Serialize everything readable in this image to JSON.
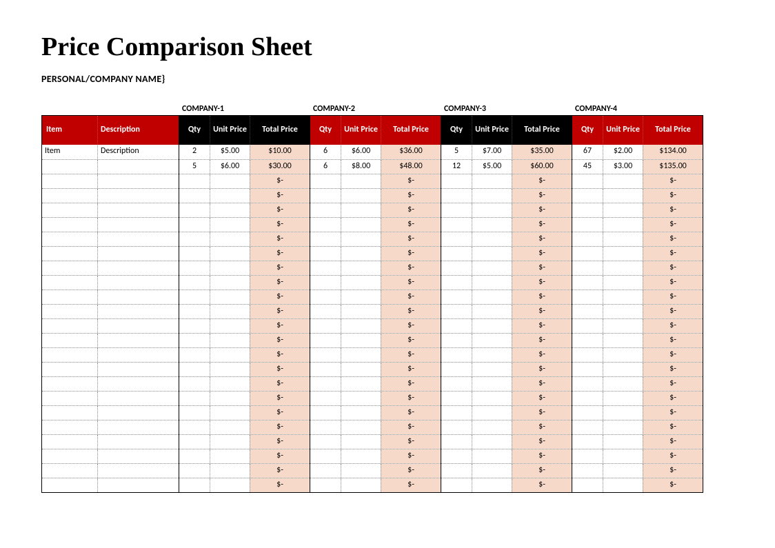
{
  "title": "Price Comparison Sheet",
  "subtitle": "PERSONAL/COMPANY NAME}",
  "columns": {
    "item": "Item",
    "description": "Description",
    "qty": "Qty",
    "unit_price": "Unit Price",
    "total_price": "Total Price"
  },
  "emptyTotal": "$-",
  "rowCount": 24,
  "itemRows": [
    {
      "item": "Item",
      "description": "Description"
    }
  ],
  "companies": [
    {
      "label": "COMPANY-1",
      "headerStyle": "black",
      "rows": [
        {
          "qty": "2",
          "unit": "$5.00",
          "total": "$10.00"
        },
        {
          "qty": "5",
          "unit": "$6.00",
          "total": "$30.00"
        }
      ]
    },
    {
      "label": "COMPANY-2",
      "headerStyle": "red",
      "rows": [
        {
          "qty": "6",
          "unit": "$6.00",
          "total": "$36.00"
        },
        {
          "qty": "6",
          "unit": "$8.00",
          "total": "$48.00"
        }
      ]
    },
    {
      "label": "COMPANY-3",
      "headerStyle": "black",
      "rows": [
        {
          "qty": "5",
          "unit": "$7.00",
          "total": "$35.00"
        },
        {
          "qty": "12",
          "unit": "$5.00",
          "total": "$60.00"
        }
      ]
    },
    {
      "label": "COMPANY-4",
      "headerStyle": "red",
      "rows": [
        {
          "qty": "67",
          "unit": "$2.00",
          "total": "$134.00"
        },
        {
          "qty": "45",
          "unit": "$3.00",
          "total": "$135.00"
        }
      ]
    }
  ]
}
